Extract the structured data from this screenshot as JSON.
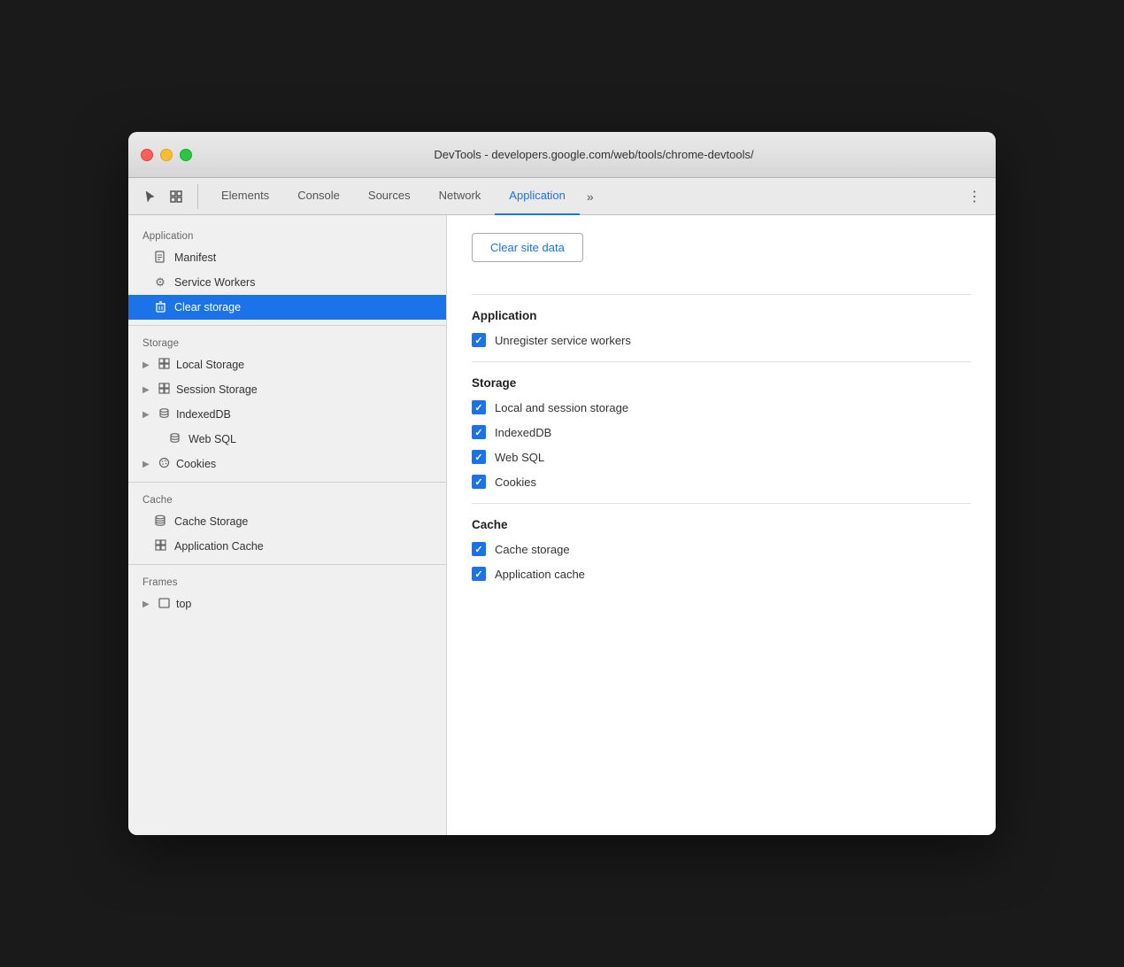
{
  "window": {
    "title": "DevTools - developers.google.com/web/tools/chrome-devtools/"
  },
  "titlebar": {
    "title": "DevTools - developers.google.com/web/tools/chrome-devtools/"
  },
  "tabs": [
    {
      "id": "elements",
      "label": "Elements",
      "active": false
    },
    {
      "id": "console",
      "label": "Console",
      "active": false
    },
    {
      "id": "sources",
      "label": "Sources",
      "active": false
    },
    {
      "id": "network",
      "label": "Network",
      "active": false
    },
    {
      "id": "application",
      "label": "Application",
      "active": true
    }
  ],
  "sidebar": {
    "sections": [
      {
        "id": "application",
        "header": "Application",
        "items": [
          {
            "id": "manifest",
            "label": "Manifest",
            "icon": "doc",
            "expandable": false,
            "active": false
          },
          {
            "id": "service-workers",
            "label": "Service Workers",
            "icon": "gear",
            "expandable": false,
            "active": false
          },
          {
            "id": "clear-storage",
            "label": "Clear storage",
            "icon": "trash",
            "expandable": false,
            "active": true
          }
        ]
      },
      {
        "id": "storage",
        "header": "Storage",
        "items": [
          {
            "id": "local-storage",
            "label": "Local Storage",
            "icon": "grid",
            "expandable": true,
            "active": false
          },
          {
            "id": "session-storage",
            "label": "Session Storage",
            "icon": "grid",
            "expandable": true,
            "active": false
          },
          {
            "id": "indexeddb",
            "label": "IndexedDB",
            "icon": "db",
            "expandable": true,
            "active": false
          },
          {
            "id": "web-sql",
            "label": "Web SQL",
            "icon": "db",
            "expandable": false,
            "active": false
          },
          {
            "id": "cookies",
            "label": "Cookies",
            "icon": "cookie",
            "expandable": true,
            "active": false
          }
        ]
      },
      {
        "id": "cache",
        "header": "Cache",
        "items": [
          {
            "id": "cache-storage",
            "label": "Cache Storage",
            "icon": "cache",
            "expandable": false,
            "active": false
          },
          {
            "id": "application-cache",
            "label": "Application Cache",
            "icon": "grid",
            "expandable": false,
            "active": false
          }
        ]
      },
      {
        "id": "frames",
        "header": "Frames",
        "items": [
          {
            "id": "top",
            "label": "top",
            "icon": "frame",
            "expandable": true,
            "active": false
          }
        ]
      }
    ]
  },
  "main": {
    "clear_button": "Clear site data",
    "sections": [
      {
        "id": "application",
        "title": "Application",
        "items": [
          {
            "id": "unregister-sw",
            "label": "Unregister service workers",
            "checked": true
          }
        ]
      },
      {
        "id": "storage",
        "title": "Storage",
        "items": [
          {
            "id": "local-session",
            "label": "Local and session storage",
            "checked": true
          },
          {
            "id": "indexeddb",
            "label": "IndexedDB",
            "checked": true
          },
          {
            "id": "web-sql",
            "label": "Web SQL",
            "checked": true
          },
          {
            "id": "cookies",
            "label": "Cookies",
            "checked": true
          }
        ]
      },
      {
        "id": "cache",
        "title": "Cache",
        "items": [
          {
            "id": "cache-storage",
            "label": "Cache storage",
            "checked": true
          },
          {
            "id": "app-cache",
            "label": "Application cache",
            "checked": true
          }
        ]
      }
    ]
  }
}
